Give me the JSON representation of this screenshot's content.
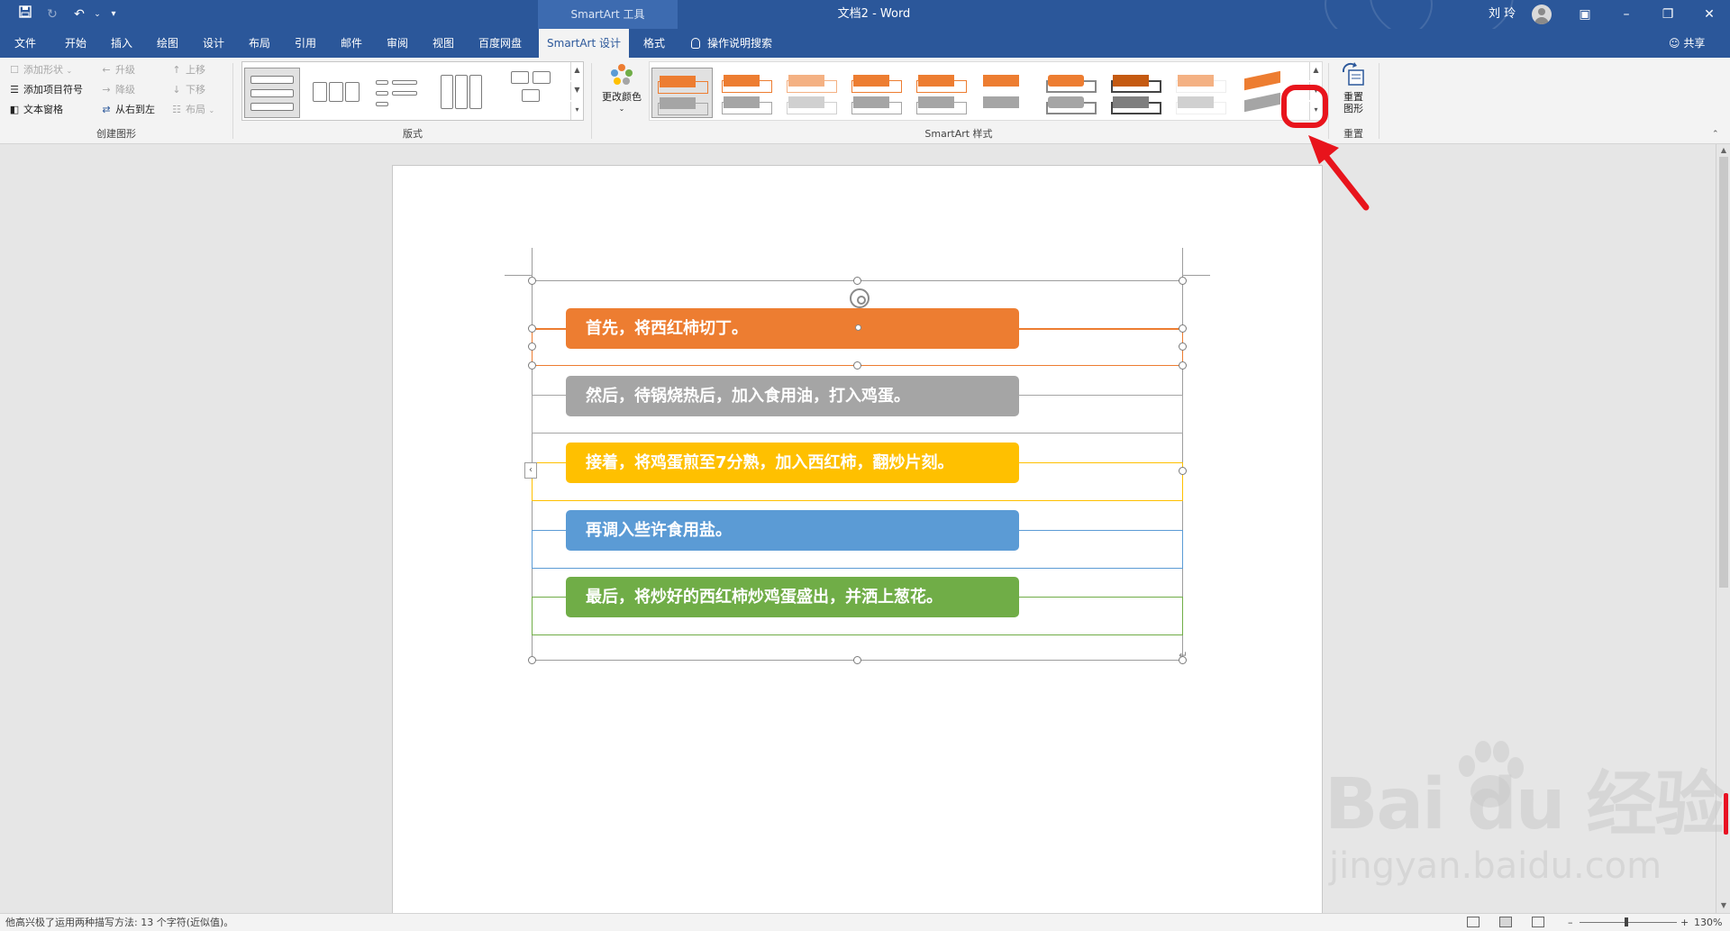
{
  "titlebar": {
    "tools_tab": "SmartArt 工具",
    "doc_title": "文档2  -  Word",
    "user": "刘 玲",
    "icons": [
      "save-icon",
      "redo-icon",
      "undo-icon",
      "customize-icon"
    ]
  },
  "tabs": [
    "文件",
    "开始",
    "插入",
    "绘图",
    "设计",
    "布局",
    "引用",
    "邮件",
    "审阅",
    "视图",
    "百度网盘",
    "SmartArt 设计",
    "格式"
  ],
  "active_tab": "SmartArt 设计",
  "tell_me": "操作说明搜索",
  "share": "共享",
  "ribbon": {
    "create_graphic": {
      "label": "创建图形",
      "add_shape": "添加形状",
      "add_bullet": "添加项目符号",
      "text_pane": "文本窗格",
      "promote": "升级",
      "demote": "降级",
      "right_to_left": "从右到左",
      "move_up": "上移",
      "move_down": "下移",
      "layout": "布局"
    },
    "layouts": {
      "label": "版式"
    },
    "smartart_styles": {
      "label": "SmartArt 样式",
      "change_colors": "更改颜色"
    },
    "reset": {
      "label": "重置",
      "reset_graphic": "重置图形"
    }
  },
  "smartart": {
    "rows": [
      {
        "text": "首先，将西红柿切丁。",
        "color": "#ed7d31"
      },
      {
        "text": "然后，待锅烧热后，加入食用油，打入鸡蛋。",
        "color": "#a5a5a5"
      },
      {
        "text": "接着，将鸡蛋煎至7分熟，加入西红柿，翻炒片刻。",
        "color": "#ffc000"
      },
      {
        "text": "再调入些许食用盐。",
        "color": "#5b9bd5"
      },
      {
        "text": "最后，将炒好的西红柿炒鸡蛋盛出，并洒上葱花。",
        "color": "#70ad47"
      }
    ]
  },
  "statusbar": {
    "text": "他高兴极了运用两种描写方法: 13 个字符(近似值)。",
    "zoom": "130%"
  },
  "watermark": {
    "logo": "Bai du 经验",
    "url": "jingyan.baidu.com"
  },
  "colors": {
    "brand": "#2b579a",
    "annotation": "#e8141c"
  }
}
